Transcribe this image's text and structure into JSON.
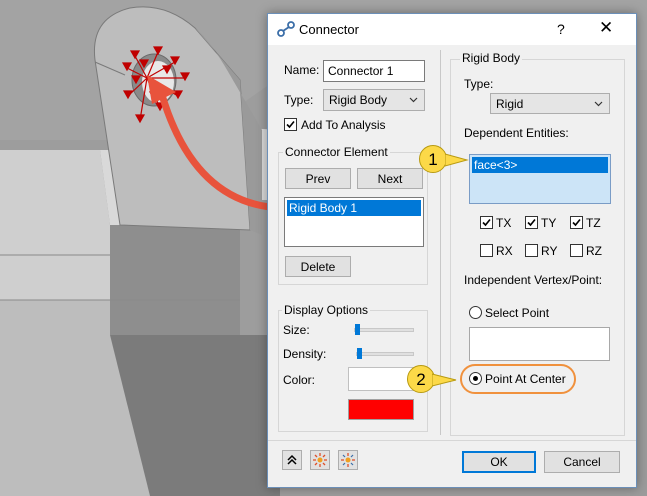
{
  "dialog": {
    "title": "Connector",
    "help_glyph": "?",
    "close_glyph": "✕",
    "name_label": "Name:",
    "name_value": "Connector 1",
    "type_label": "Type:",
    "type_value": "Rigid Body",
    "add_to_analysis_label": "Add To Analysis",
    "add_to_analysis_checked": true,
    "connector_element": {
      "title": "Connector Element",
      "prev_label": "Prev",
      "next_label": "Next",
      "items": [
        "Rigid Body 1"
      ],
      "delete_label": "Delete"
    },
    "display_options": {
      "title": "Display Options",
      "size_label": "Size:",
      "size_level": 0.0,
      "density_label": "Density:",
      "density_level": 0.0,
      "color_label": "Color:",
      "color_value": "#ff0000"
    },
    "rigid_body": {
      "title": "Rigid Body",
      "type_label": "Type:",
      "type_value": "Rigid",
      "dependent_label": "Dependent Entities:",
      "dependent_items": [
        "face<3>"
      ],
      "dofs": [
        {
          "label": "TX",
          "checked": true
        },
        {
          "label": "TY",
          "checked": true
        },
        {
          "label": "TZ",
          "checked": true
        },
        {
          "label": "RX",
          "checked": false
        },
        {
          "label": "RY",
          "checked": false
        },
        {
          "label": "RZ",
          "checked": false
        }
      ],
      "independent_label": "Independent Vertex/Point:",
      "select_point_label": "Select Point",
      "point_at_center_label": "Point At Center"
    },
    "ok_label": "OK",
    "cancel_label": "Cancel"
  },
  "callouts": {
    "one": "1",
    "two": "2"
  },
  "colors": {
    "accent": "#f26b3a",
    "callout_fill": "#fcd948",
    "selection": "#0078d7",
    "model_red": "#c00000"
  }
}
